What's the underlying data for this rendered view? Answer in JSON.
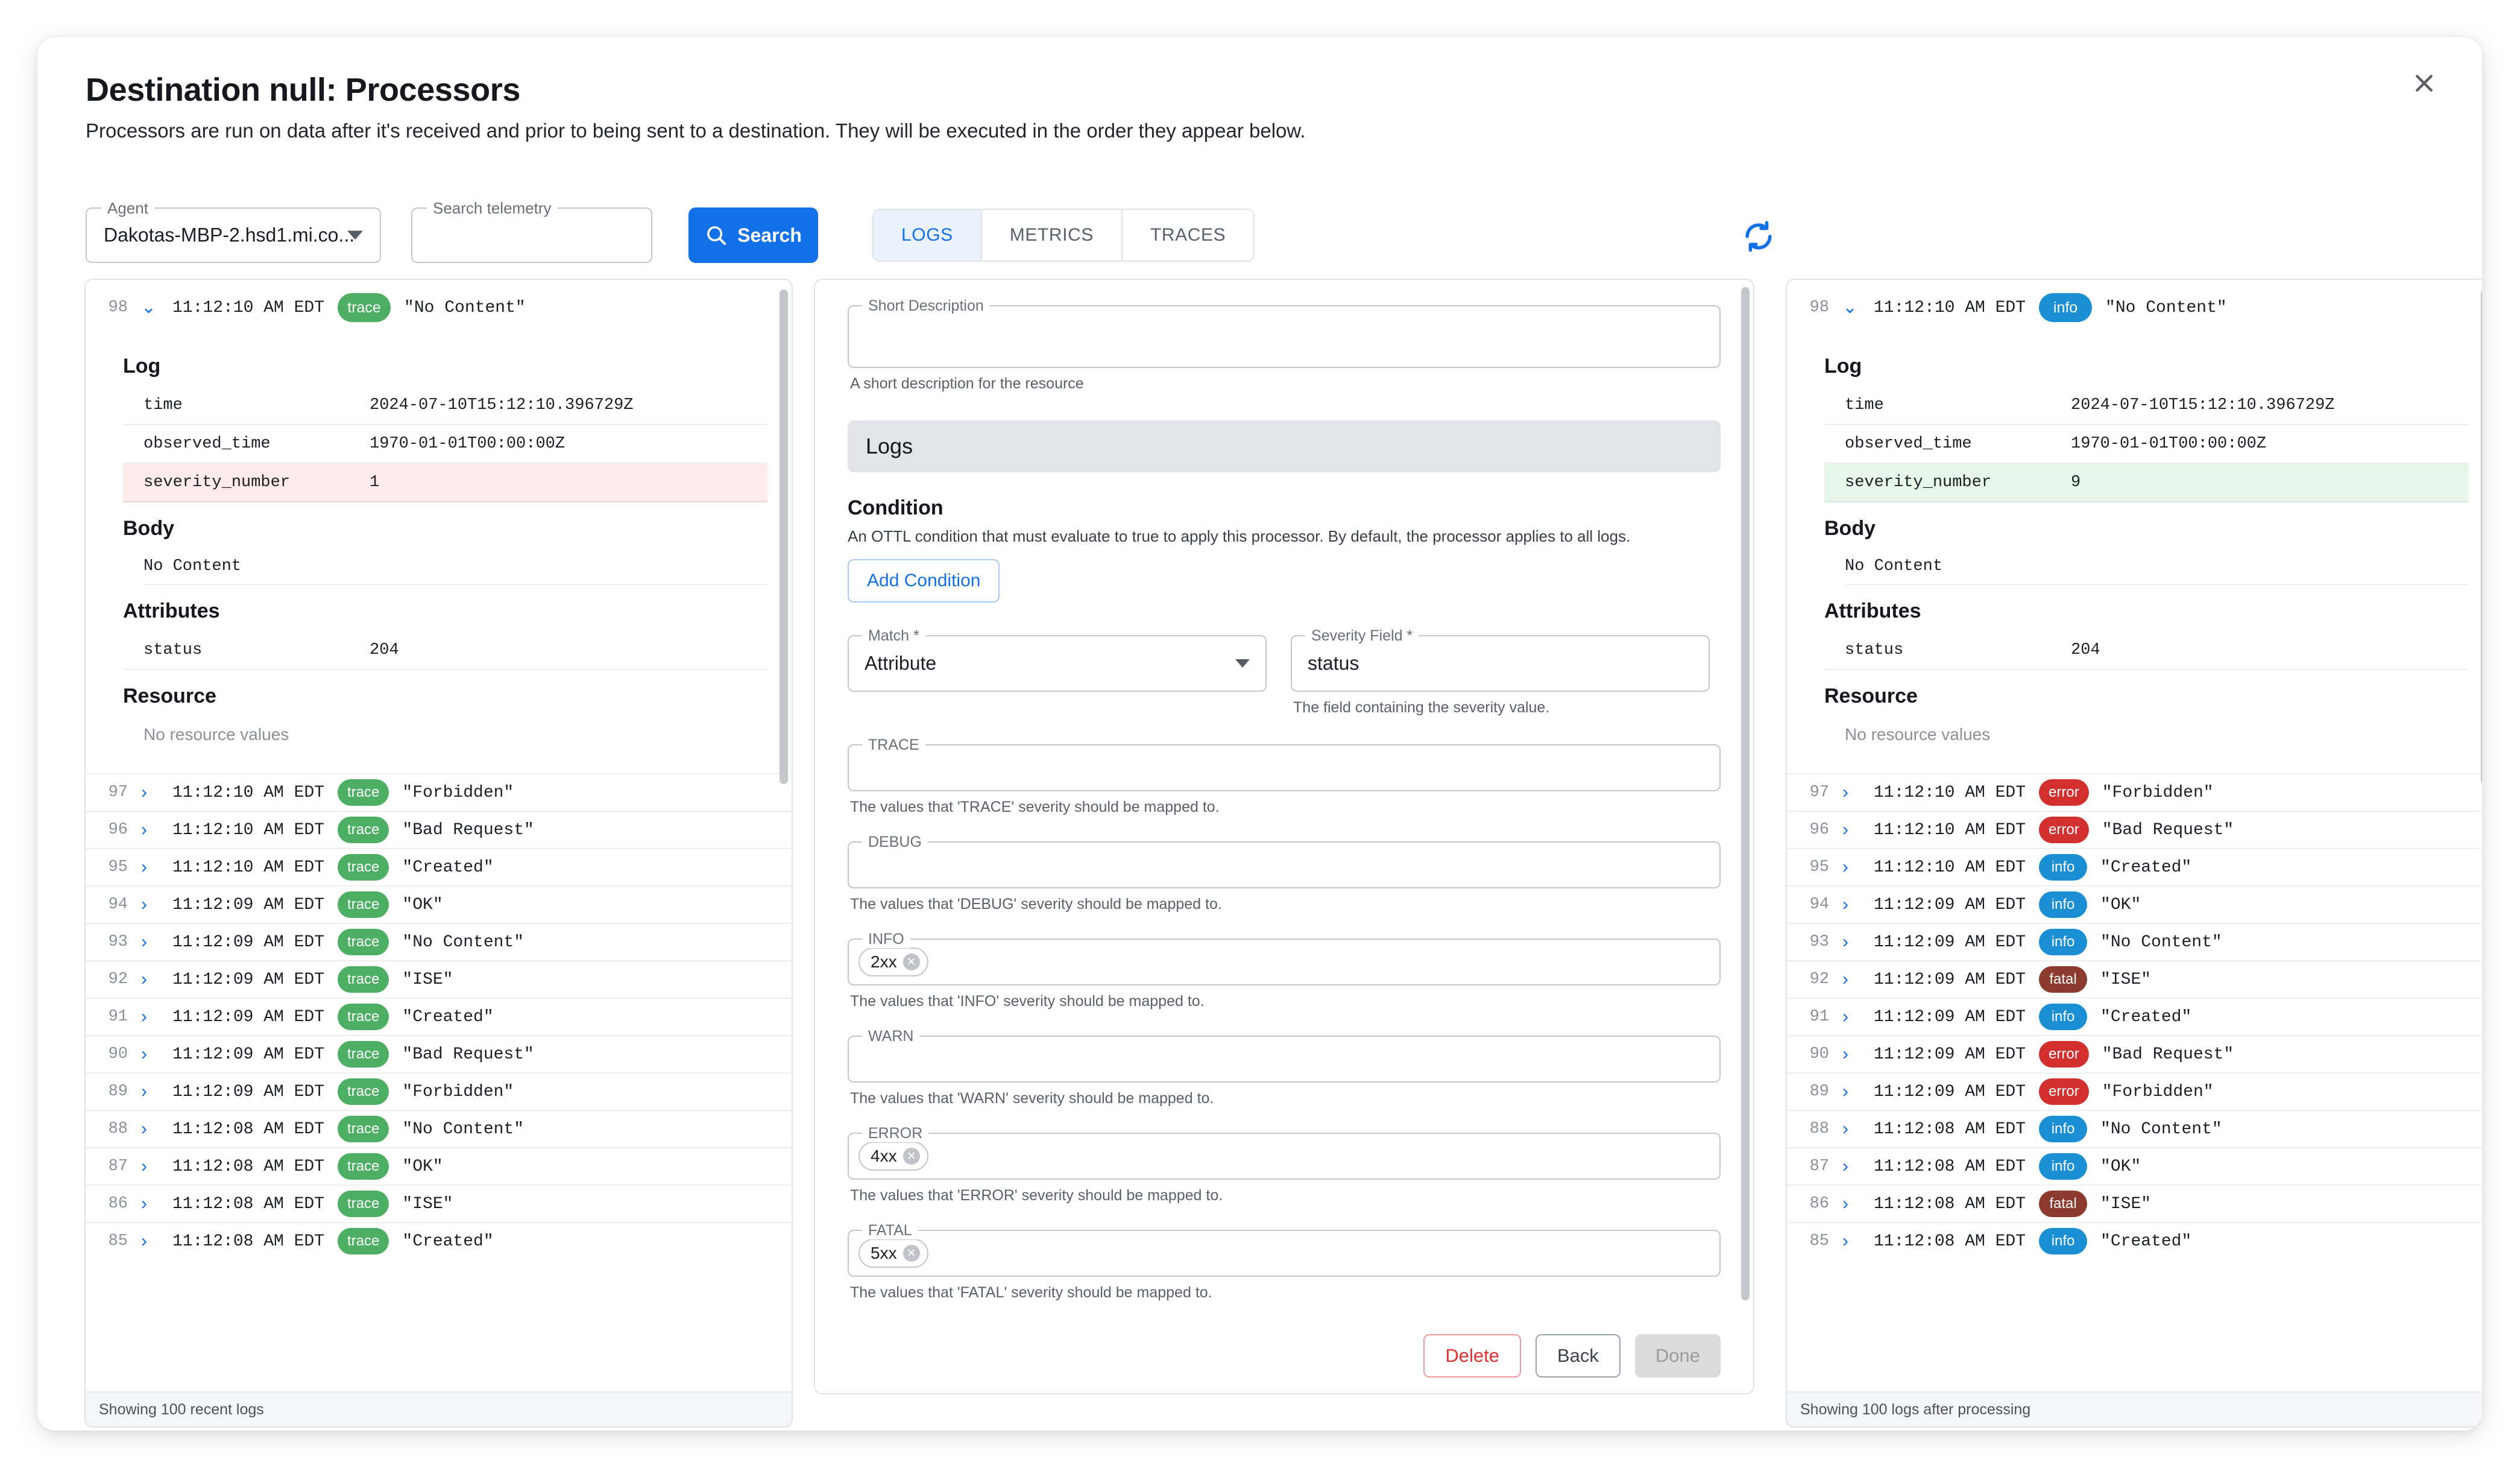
{
  "dialog": {
    "title": "Destination null: Processors",
    "subtitle": "Processors are run on data after it's received and prior to being sent to a destination. They will be executed in the order they appear below.",
    "close_icon": "close-icon"
  },
  "toolbar": {
    "agent": {
      "legend": "Agent",
      "value": "Dakotas-MBP-2.hsd1.mi.co...",
      "caret_icon": "chevron-down-icon"
    },
    "search_telemetry": {
      "legend": "Search telemetry",
      "value": "",
      "placeholder": ""
    },
    "search_button": {
      "label": "Search",
      "icon": "search-icon"
    },
    "tabs": [
      {
        "label": "LOGS",
        "active": true
      },
      {
        "label": "METRICS",
        "active": false
      },
      {
        "label": "TRACES",
        "active": false
      }
    ],
    "refresh_icon": "refresh-icon"
  },
  "colors": {
    "accent": "#1271e8",
    "trace": "#4caf63",
    "info": "#1b8fd4",
    "error": "#d32f2f",
    "fatal": "#8c3a2d",
    "delete": "#e03131",
    "highlight_red": "#fdebeb",
    "highlight_green": "#e6f6e9"
  },
  "left_panel": {
    "footer": "Showing 100 recent logs",
    "expanded": {
      "index": "98",
      "chevron_icon": "chevron-down-icon",
      "timestamp": "11:12:10 AM EDT",
      "severity": "trace",
      "body": "\"No Content\"",
      "log_section_title": "Log",
      "log_fields": [
        {
          "key": "time",
          "value": "2024-07-10T15:12:10.396729Z",
          "highlight": ""
        },
        {
          "key": "observed_time",
          "value": "1970-01-01T00:00:00Z",
          "highlight": ""
        },
        {
          "key": "severity_number",
          "value": "1",
          "highlight": "red"
        }
      ],
      "body_section_title": "Body",
      "body_value": "No Content",
      "attributes_section_title": "Attributes",
      "attributes": [
        {
          "key": "status",
          "value": "204"
        }
      ],
      "resource_section_title": "Resource",
      "resource_empty": "No resource values"
    },
    "rows": [
      {
        "index": "97",
        "timestamp": "11:12:10 AM EDT",
        "severity": "trace",
        "body": "\"Forbidden\""
      },
      {
        "index": "96",
        "timestamp": "11:12:10 AM EDT",
        "severity": "trace",
        "body": "\"Bad Request\""
      },
      {
        "index": "95",
        "timestamp": "11:12:10 AM EDT",
        "severity": "trace",
        "body": "\"Created\""
      },
      {
        "index": "94",
        "timestamp": "11:12:09 AM EDT",
        "severity": "trace",
        "body": "\"OK\""
      },
      {
        "index": "93",
        "timestamp": "11:12:09 AM EDT",
        "severity": "trace",
        "body": "\"No Content\""
      },
      {
        "index": "92",
        "timestamp": "11:12:09 AM EDT",
        "severity": "trace",
        "body": "\"ISE\""
      },
      {
        "index": "91",
        "timestamp": "11:12:09 AM EDT",
        "severity": "trace",
        "body": "\"Created\""
      },
      {
        "index": "90",
        "timestamp": "11:12:09 AM EDT",
        "severity": "trace",
        "body": "\"Bad Request\""
      },
      {
        "index": "89",
        "timestamp": "11:12:09 AM EDT",
        "severity": "trace",
        "body": "\"Forbidden\""
      },
      {
        "index": "88",
        "timestamp": "11:12:08 AM EDT",
        "severity": "trace",
        "body": "\"No Content\""
      },
      {
        "index": "87",
        "timestamp": "11:12:08 AM EDT",
        "severity": "trace",
        "body": "\"OK\""
      },
      {
        "index": "86",
        "timestamp": "11:12:08 AM EDT",
        "severity": "trace",
        "body": "\"ISE\""
      },
      {
        "index": "85",
        "timestamp": "11:12:08 AM EDT",
        "severity": "trace",
        "body": "\"Created\""
      }
    ]
  },
  "right_panel": {
    "footer": "Showing 100 logs after processing",
    "expanded": {
      "index": "98",
      "chevron_icon": "chevron-down-icon",
      "timestamp": "11:12:10 AM EDT",
      "severity": "info",
      "body": "\"No Content\"",
      "log_section_title": "Log",
      "log_fields": [
        {
          "key": "time",
          "value": "2024-07-10T15:12:10.396729Z",
          "highlight": ""
        },
        {
          "key": "observed_time",
          "value": "1970-01-01T00:00:00Z",
          "highlight": ""
        },
        {
          "key": "severity_number",
          "value": "9",
          "highlight": "green"
        }
      ],
      "body_section_title": "Body",
      "body_value": "No Content",
      "attributes_section_title": "Attributes",
      "attributes": [
        {
          "key": "status",
          "value": "204"
        }
      ],
      "resource_section_title": "Resource",
      "resource_empty": "No resource values"
    },
    "rows": [
      {
        "index": "97",
        "timestamp": "11:12:10 AM EDT",
        "severity": "error",
        "body": "\"Forbidden\""
      },
      {
        "index": "96",
        "timestamp": "11:12:10 AM EDT",
        "severity": "error",
        "body": "\"Bad Request\""
      },
      {
        "index": "95",
        "timestamp": "11:12:10 AM EDT",
        "severity": "info",
        "body": "\"Created\""
      },
      {
        "index": "94",
        "timestamp": "11:12:09 AM EDT",
        "severity": "info",
        "body": "\"OK\""
      },
      {
        "index": "93",
        "timestamp": "11:12:09 AM EDT",
        "severity": "info",
        "body": "\"No Content\""
      },
      {
        "index": "92",
        "timestamp": "11:12:09 AM EDT",
        "severity": "fatal",
        "body": "\"ISE\""
      },
      {
        "index": "91",
        "timestamp": "11:12:09 AM EDT",
        "severity": "info",
        "body": "\"Created\""
      },
      {
        "index": "90",
        "timestamp": "11:12:09 AM EDT",
        "severity": "error",
        "body": "\"Bad Request\""
      },
      {
        "index": "89",
        "timestamp": "11:12:09 AM EDT",
        "severity": "error",
        "body": "\"Forbidden\""
      },
      {
        "index": "88",
        "timestamp": "11:12:08 AM EDT",
        "severity": "info",
        "body": "\"No Content\""
      },
      {
        "index": "87",
        "timestamp": "11:12:08 AM EDT",
        "severity": "info",
        "body": "\"OK\""
      },
      {
        "index": "86",
        "timestamp": "11:12:08 AM EDT",
        "severity": "fatal",
        "body": "\"ISE\""
      },
      {
        "index": "85",
        "timestamp": "11:12:08 AM EDT",
        "severity": "info",
        "body": "\"Created\""
      }
    ]
  },
  "form": {
    "short_description": {
      "legend": "Short Description",
      "value": "",
      "helper": "A short description for the resource"
    },
    "section_logs": "Logs",
    "condition": {
      "title": "Condition",
      "description": "An OTTL condition that must evaluate to true to apply this processor. By default, the processor applies to all logs.",
      "add_button": "Add Condition"
    },
    "match": {
      "legend": "Match *",
      "value": "Attribute",
      "caret_icon": "chevron-down-icon"
    },
    "severity_field": {
      "legend": "Severity Field *",
      "value": "status",
      "helper": "The field containing the severity value."
    },
    "mappings": [
      {
        "legend": "TRACE",
        "chips": [],
        "helper": "The values that 'TRACE' severity should be mapped to."
      },
      {
        "legend": "DEBUG",
        "chips": [],
        "helper": "The values that 'DEBUG' severity should be mapped to."
      },
      {
        "legend": "INFO",
        "chips": [
          "2xx"
        ],
        "helper": "The values that 'INFO' severity should be mapped to."
      },
      {
        "legend": "WARN",
        "chips": [],
        "helper": "The values that 'WARN' severity should be mapped to."
      },
      {
        "legend": "ERROR",
        "chips": [
          "4xx"
        ],
        "helper": "The values that 'ERROR' severity should be mapped to."
      },
      {
        "legend": "FATAL",
        "chips": [
          "5xx"
        ],
        "helper": "The values that 'FATAL' severity should be mapped to."
      }
    ],
    "buttons": {
      "delete": "Delete",
      "back": "Back",
      "done": "Done"
    }
  }
}
